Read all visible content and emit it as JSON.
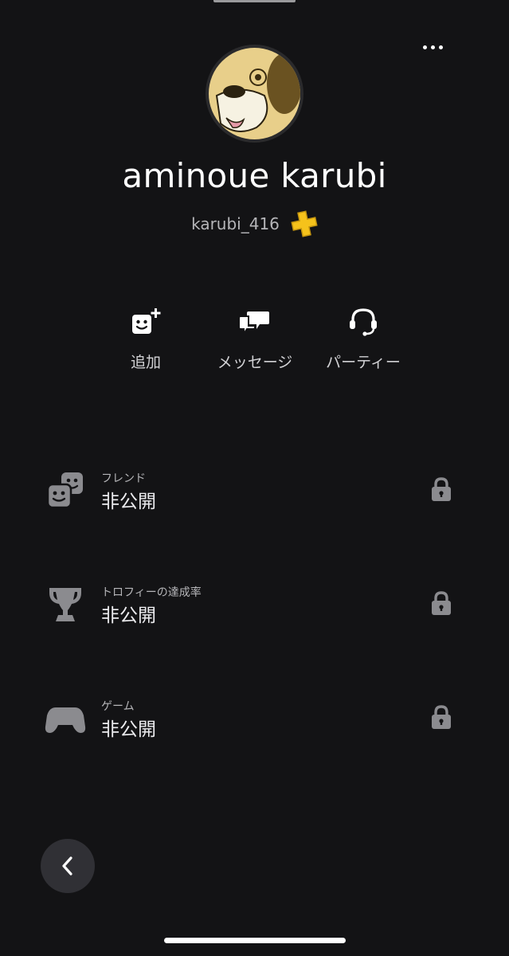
{
  "profile": {
    "display_name": "aminoue karubi",
    "online_id": "karubi_416",
    "avatar_icon": "dog-face-avatar",
    "membership_badge_icon": "ps-plus-icon"
  },
  "actions": [
    {
      "label": "追加",
      "icon": "add-friend-icon"
    },
    {
      "label": "メッセージ",
      "icon": "message-icon"
    },
    {
      "label": "パーティー",
      "icon": "headset-icon"
    }
  ],
  "sections": [
    {
      "caption": "フレンド",
      "value": "非公開",
      "icon": "friends-icon"
    },
    {
      "caption": "トロフィーの達成率",
      "value": "非公開",
      "icon": "trophy-icon"
    },
    {
      "caption": "ゲーム",
      "value": "非公開",
      "icon": "gamepad-icon"
    }
  ],
  "colors": {
    "background": "#131315",
    "accent_gold": "#f5c21b",
    "icon_gray": "#8b8b8f",
    "text_muted": "#b5b5b8"
  }
}
